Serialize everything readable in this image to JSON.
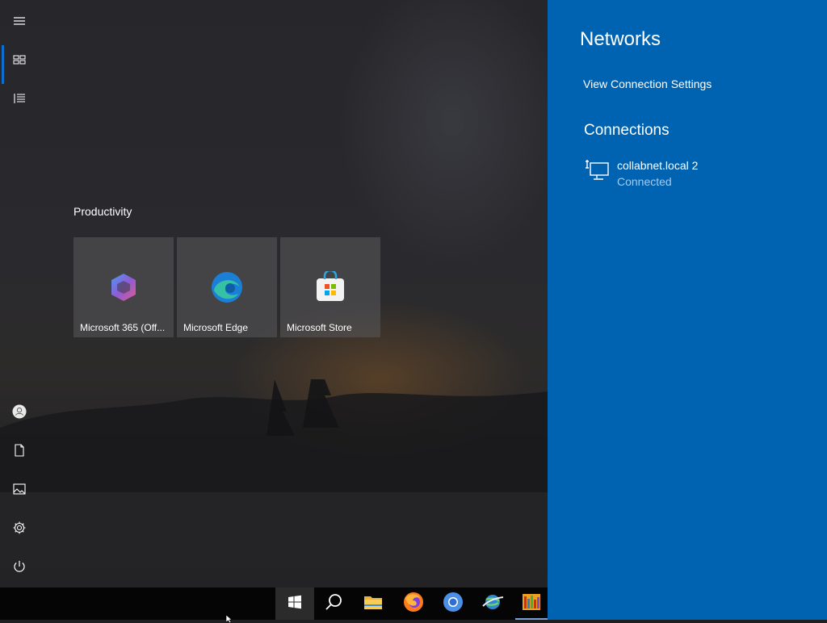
{
  "start_menu": {
    "rail": {
      "top": [
        {
          "name": "hamburger-icon"
        },
        {
          "name": "all-tiles-icon"
        },
        {
          "name": "all-apps-list-icon"
        }
      ],
      "bottom": [
        {
          "name": "user-account-icon"
        },
        {
          "name": "documents-icon"
        },
        {
          "name": "pictures-icon"
        },
        {
          "name": "settings-icon"
        },
        {
          "name": "power-icon"
        }
      ]
    },
    "group": {
      "title": "Productivity",
      "tiles": [
        {
          "label": "Microsoft 365 (Off...",
          "icon": "microsoft-365-icon"
        },
        {
          "label": "Microsoft Edge",
          "icon": "microsoft-edge-icon"
        },
        {
          "label": "Microsoft Store",
          "icon": "microsoft-store-icon"
        }
      ]
    }
  },
  "network_flyout": {
    "title": "Networks",
    "settings_link": "View Connection Settings",
    "connections_title": "Connections",
    "connections": [
      {
        "name": "collabnet.local 2",
        "status": "Connected",
        "icon": "ethernet-monitor-icon"
      }
    ],
    "background_color": "#0063b1"
  },
  "taskbar": {
    "items": [
      {
        "name": "start-button",
        "icon": "windows-logo-icon"
      },
      {
        "name": "search-button",
        "icon": "search-icon"
      },
      {
        "name": "file-explorer-button",
        "icon": "folder-icon"
      },
      {
        "name": "firefox-button",
        "icon": "firefox-icon"
      },
      {
        "name": "chrome-button",
        "icon": "chrome-icon"
      },
      {
        "name": "network-app-button",
        "icon": "globe-icon"
      },
      {
        "name": "app-button",
        "icon": "colorful-app-icon"
      }
    ]
  }
}
